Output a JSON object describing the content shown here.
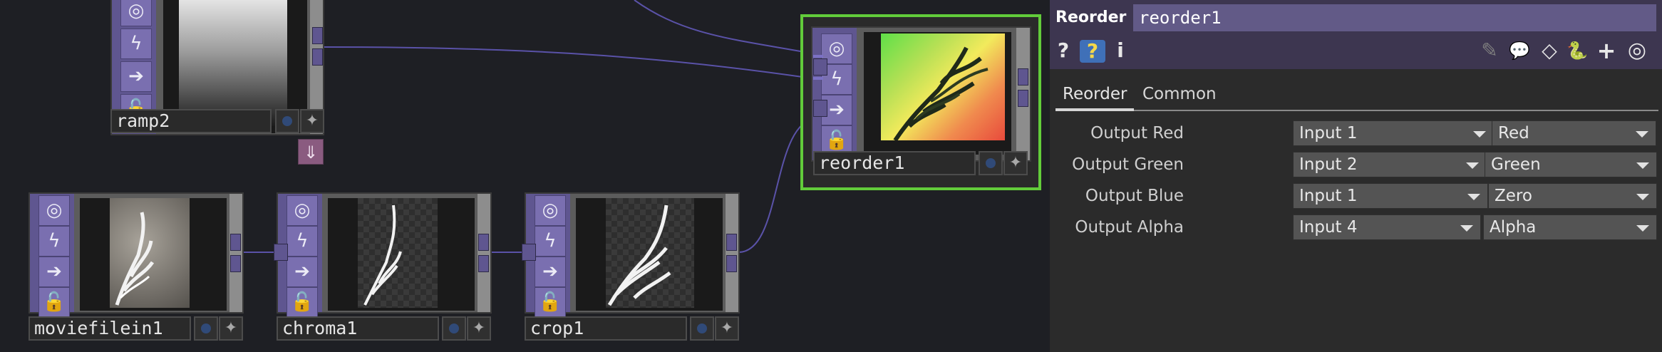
{
  "network": {
    "nodes": {
      "ramp2": {
        "name": "ramp2"
      },
      "reorder1": {
        "name": "reorder1"
      },
      "moviefilein1": {
        "name": "moviefilein1"
      },
      "chroma1": {
        "name": "chroma1"
      },
      "crop1": {
        "name": "crop1"
      }
    },
    "viewer_buttons": {
      "viewer_active": "◎",
      "bypass": "ϟ",
      "display": "➔",
      "lock": "🔓"
    },
    "flag_star": "✦",
    "down_arrow": "⇓",
    "selected_color": "#62cc3a",
    "node_color": "#5f5690"
  },
  "panel": {
    "op_type": "Reorder",
    "op_name": "reorder1",
    "header_icons": {
      "help": "?",
      "python_help": "?",
      "info": "i",
      "pencil": "✎",
      "comment": "💬",
      "clone": "◇",
      "python": "🐍",
      "add": "+",
      "viewer": "◎"
    },
    "tabs": [
      "Reorder",
      "Common"
    ],
    "active_tab": "Reorder",
    "params": [
      {
        "label": "Output Red",
        "input": "Input 1",
        "channel": "Red"
      },
      {
        "label": "Output Green",
        "input": "Input 2",
        "channel": "Green"
      },
      {
        "label": "Output Blue",
        "input": "Input 1",
        "channel": "Zero"
      },
      {
        "label": "Output Alpha",
        "input": "Input 4",
        "channel": "Alpha"
      }
    ]
  }
}
